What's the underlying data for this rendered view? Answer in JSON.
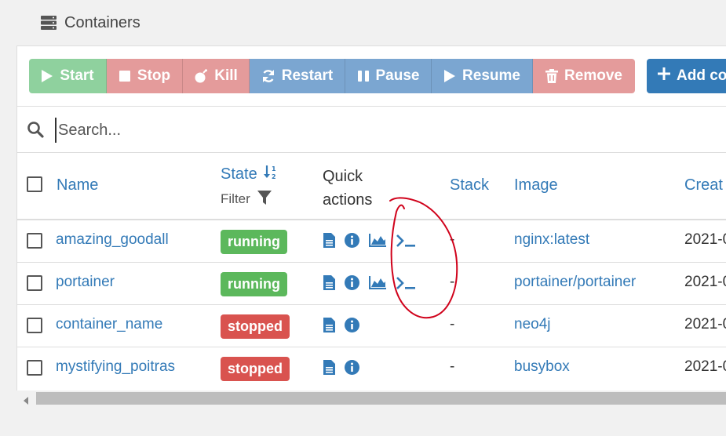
{
  "panel": {
    "title": "Containers"
  },
  "toolbar": {
    "buttons": [
      {
        "label": "Start",
        "color": "#8fd19e"
      },
      {
        "label": "Stop",
        "color": "#e49b9b"
      },
      {
        "label": "Kill",
        "color": "#e49b9b"
      },
      {
        "label": "Restart",
        "color": "#7ba6d1"
      },
      {
        "label": "Pause",
        "color": "#7ba6d1"
      },
      {
        "label": "Resume",
        "color": "#7ba6d1"
      },
      {
        "label": "Remove",
        "color": "#e49b9b"
      }
    ],
    "add_label": "Add co"
  },
  "search": {
    "placeholder": "Search..."
  },
  "table": {
    "headers": {
      "name": "Name",
      "state": "State",
      "state_filter": "Filter",
      "quick_actions_1": "Quick",
      "quick_actions_2": "actions",
      "stack": "Stack",
      "image": "Image",
      "created": "Creat"
    },
    "rows": [
      {
        "name": "amazing_goodall",
        "state": "running",
        "stack": "-",
        "image": "nginx:latest",
        "created": "2021-0"
      },
      {
        "name": "portainer",
        "state": "running",
        "stack": "-",
        "image": "portainer/portainer",
        "created": "2021-0"
      },
      {
        "name": "container_name",
        "state": "stopped",
        "stack": "-",
        "image": "neo4j",
        "created": "2021-0"
      },
      {
        "name": "mystifying_poitras",
        "state": "stopped",
        "stack": "-",
        "image": "busybox",
        "created": "2021-0"
      }
    ]
  },
  "colors": {
    "running": "#5cb85c",
    "stopped": "#d9534f",
    "link": "#337ab7",
    "annotation": "#d0021b"
  }
}
